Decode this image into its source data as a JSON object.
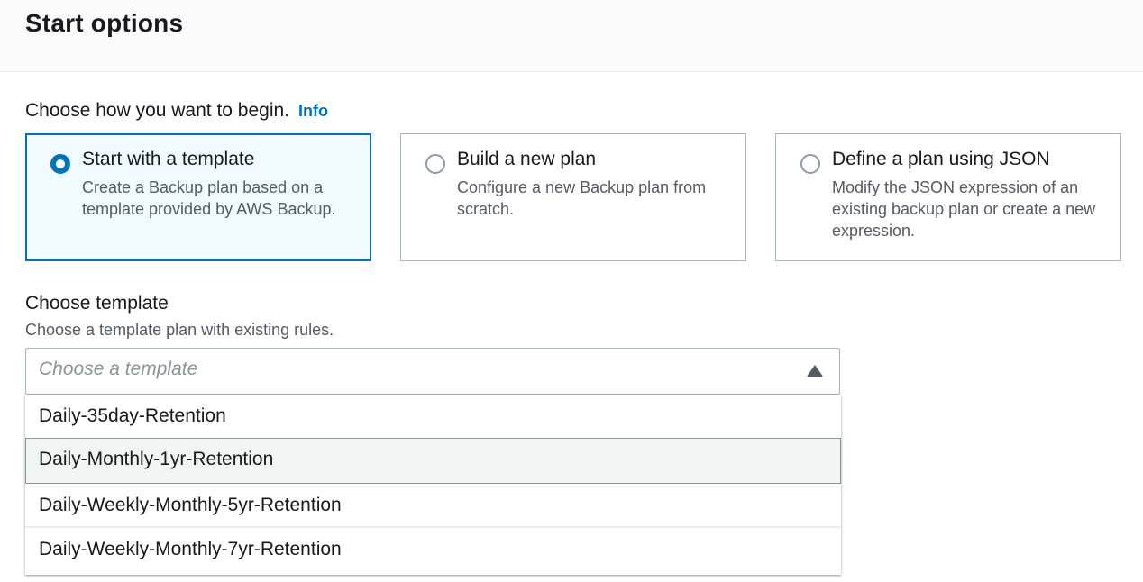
{
  "header": {
    "title": "Start options"
  },
  "start": {
    "prompt": "Choose how you want to begin.",
    "info_label": "Info",
    "options": [
      {
        "title": "Start with a template",
        "description": "Create a Backup plan based on a template provided by AWS Backup.",
        "selected": true
      },
      {
        "title": "Build a new plan",
        "description": "Configure a new Backup plan from scratch.",
        "selected": false
      },
      {
        "title": "Define a plan using JSON",
        "description": "Modify the JSON expression of an existing backup plan or create a new expression.",
        "selected": false
      }
    ]
  },
  "template": {
    "label": "Choose template",
    "description": "Choose a template plan with existing rules.",
    "placeholder": "Choose a template",
    "icon": "caret-up-icon",
    "options": [
      "Daily-35day-Retention",
      "Daily-Monthly-1yr-Retention",
      "Daily-Weekly-Monthly-5yr-Retention",
      "Daily-Weekly-Monthly-7yr-Retention"
    ],
    "highlighted_option": "Daily-Monthly-1yr-Retention"
  },
  "colors": {
    "accent": "#0073bb",
    "selected_tile_bg": "#f1faff",
    "border": "#aab7b8",
    "text": "#16191f",
    "secondary_text": "#545b64"
  }
}
